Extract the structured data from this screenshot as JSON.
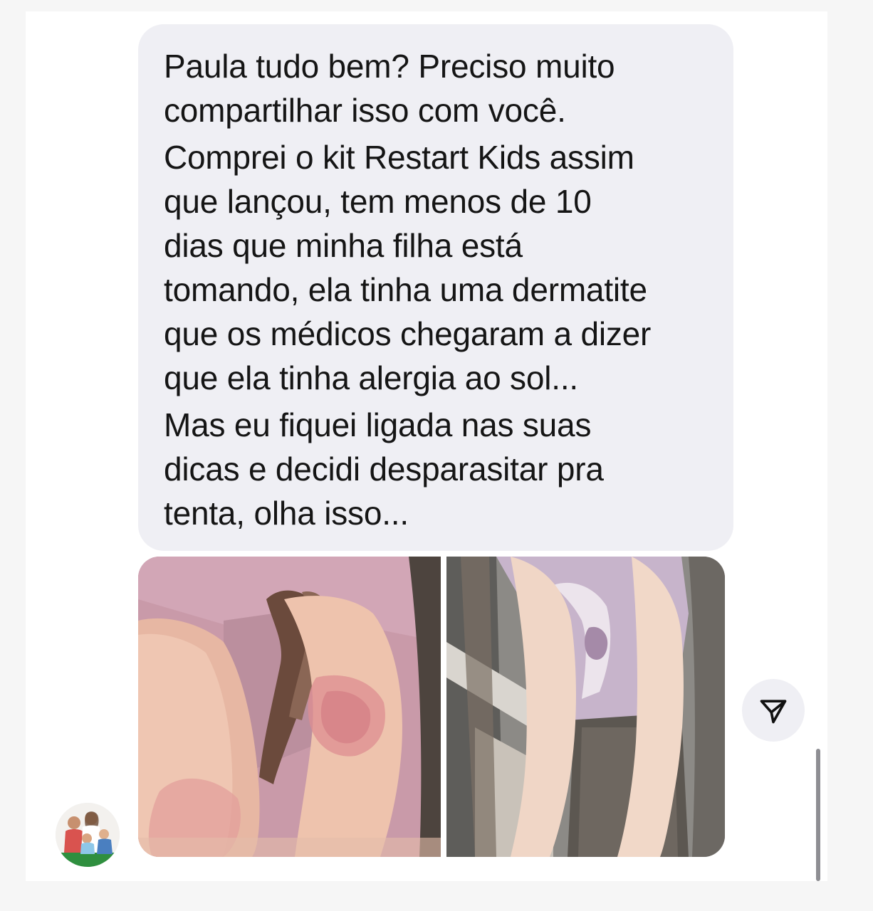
{
  "message": {
    "paragraphs": [
      {
        "lines": [
          "Paula tudo bem? Preciso muito",
          "compartilhar isso com você."
        ]
      },
      {
        "lines": [
          "Comprei o kit Restart Kids assim",
          "que lançou, tem menos de 10",
          "dias que minha filha está",
          "tomando, ela tinha uma dermatite",
          "que os médicos chegaram a dizer",
          "que ela tinha alergia ao sol..."
        ]
      },
      {
        "lines": [
          "Mas eu fiquei ligada nas suas",
          "dicas e decidi desparasitar pra",
          "tenta, olha isso..."
        ]
      }
    ]
  },
  "attachment": {
    "photos": [
      "before-photo",
      "after-photo"
    ]
  },
  "icons": {
    "share": "paper-plane-icon",
    "avatar": "family-avatar"
  },
  "colors": {
    "bubble": "#efeff4",
    "text": "#151515",
    "background": "#ffffff",
    "scrollbar": "#8e8e93"
  }
}
